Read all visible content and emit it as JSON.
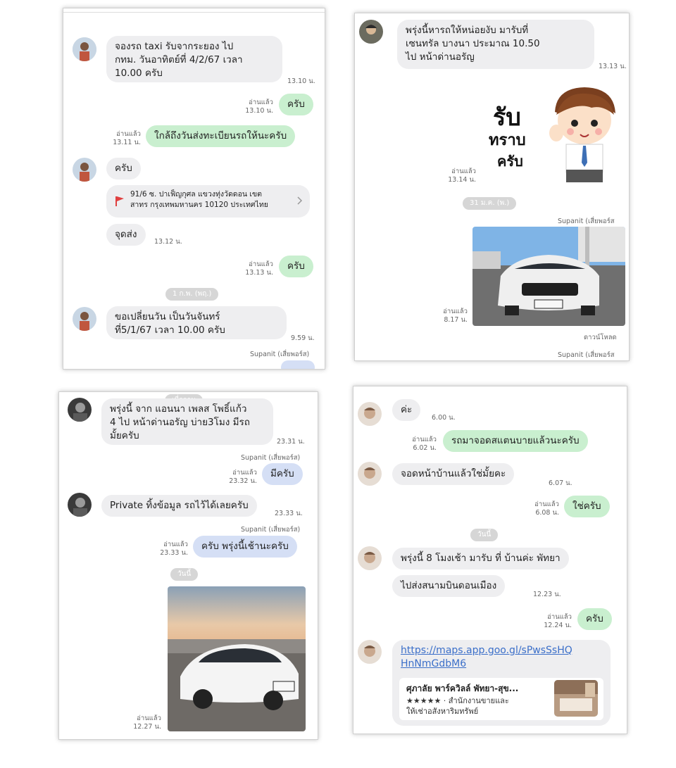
{
  "panel1": {
    "msg1": [
      "จองรถ taxi รับจากระยอง ไป",
      "กทม. วันอาทิตย์ที่ 4/2/67 เวลา",
      "10.00 ครับ"
    ],
    "time1": "13.10 น.",
    "read1": "อ่านแล้ว",
    "time2": "13.10 น.",
    "msg2": "ครับ",
    "read2": "อ่านแล้ว",
    "time3": "13.11 น.",
    "msg3": "ใกล้ถึงวันส่งทะเบียนรถให้นะครับ",
    "msg4": "ครับ",
    "location": [
      "91/6 ซ. ปาเฟ็ญกุศล แขวงทุ่งวัดดอน เขต",
      "สาทร กรุงเทพมหานคร 10120 ประเทศไทย"
    ],
    "msg5": "จุดส่ง",
    "time5": "13.12 น.",
    "read6": "อ่านแล้ว",
    "time6": "13.13 น.",
    "msg6": "ครับ",
    "date": "1 ก.พ. (พฤ.)",
    "msg7": [
      "ขอเปลี่ยนวัน เป็นวันจันทร์",
      "ที่5/1/67 เวลา 10.00 ครับ"
    ],
    "time7": "9.59 น.",
    "sender": "Supanit (เสี่ยพอร์ส)"
  },
  "panel2": {
    "msg1": [
      "พรุ่งนี้หารถให้หน่อยงับ มารับที่",
      "เซนทรัล บางนา ประมาณ 10.50",
      "ไป หน้าด่านอรัญ"
    ],
    "time1": "13.13 น.",
    "sticker": [
      "รับ",
      "ทราบ",
      "ครับ"
    ],
    "read2": "อ่านแล้ว",
    "time2": "13.14 น.",
    "date": "31 ม.ค. (พ.)",
    "sender": "Supanit (เสี่ยพอร์ส",
    "read3": "อ่านแล้ว",
    "time3": "8.17 น.",
    "download": "ดาวน์โหลด",
    "sender2": "Supanit (เสี่ยพอร์ส"
  },
  "panel3": {
    "topchip": "เมื่อวาน",
    "msg1": [
      "พรุ่งนี้ จาก แอนนา เพลส โพธิ์แก้ว",
      "4  ไป หน้าด่านอรัญ บ่าย3โมง มีรถ",
      "มั้ยครับ"
    ],
    "time1": "23.31 น.",
    "sender1": "Supanit (เสี่ยพอร์ส)",
    "read2": "อ่านแล้ว",
    "time2": "23.32 น.",
    "msg2": "มีครับ",
    "msg3": "Private ทิ้งข้อมูล รถไว้ได้เลยครับ",
    "time3": "23.33 น.",
    "sender2": "Supanit (เสี่ยพอร์ส)",
    "read4": "อ่านแล้ว",
    "time4": "23.33 น.",
    "msg4": "ครับ พรุ่งนี้เช้านะครับ",
    "date": "วันนี้",
    "read5": "อ่านแล้ว",
    "time5": "12.27 น."
  },
  "panel4": {
    "msg1": "ค่ะ",
    "time1": "6.00 น.",
    "read2": "อ่านแล้ว",
    "time2": "6.02 น.",
    "msg2": "รถมาจอดสแตนบายแล้วนะครับ",
    "msg3": "จอดหน้าบ้านแล้วใช่มั้ยคะ",
    "time3": "6.07 น.",
    "read4": "อ่านแล้ว",
    "time4": "6.08 น.",
    "msg4": "ใช่ครับ",
    "date": "วันนี้",
    "msg5": "พรุ่งนี้ 8 โมงเช้า มารับ ที่ บ้านค่ะ พัทยา",
    "msg6": "ไปส่งสนามบินดอนเมือง",
    "time6": "12.23 น.",
    "read7": "อ่านแล้ว",
    "time7": "12.24 น.",
    "msg7": "ครับ",
    "link": [
      "https://maps.app.goo.gl/sPwsSsHQ",
      "HnNmGdbM6"
    ],
    "place_title": "ศุภาลัย พาร์ควิลล์ พัทยา-สุข...",
    "place_desc": [
      "★★★★★ · สำนักงานขายและ",
      "ให้เช่าอสังหาริมทรัพย์"
    ]
  }
}
